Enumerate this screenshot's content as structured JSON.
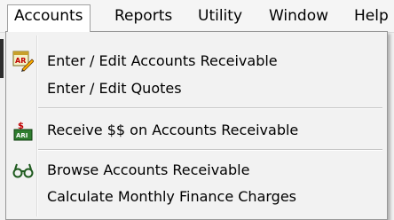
{
  "menubar": {
    "items": [
      {
        "label": "Accounts"
      },
      {
        "label": "Reports"
      },
      {
        "label": "Utility"
      },
      {
        "label": "Window"
      },
      {
        "label": "Help"
      }
    ]
  },
  "dropdown": {
    "items": [
      {
        "label": "Enter / Edit Accounts Receivable",
        "icon": "ar-edit-icon"
      },
      {
        "label": "Enter / Edit Quotes"
      },
      {
        "label": "Receive $$ on Accounts Receivable",
        "icon": "receive-money-icon"
      },
      {
        "label": "Browse Accounts Receivable",
        "icon": "binoculars-icon"
      },
      {
        "label": "Calculate Monthly Finance Charges"
      }
    ]
  }
}
